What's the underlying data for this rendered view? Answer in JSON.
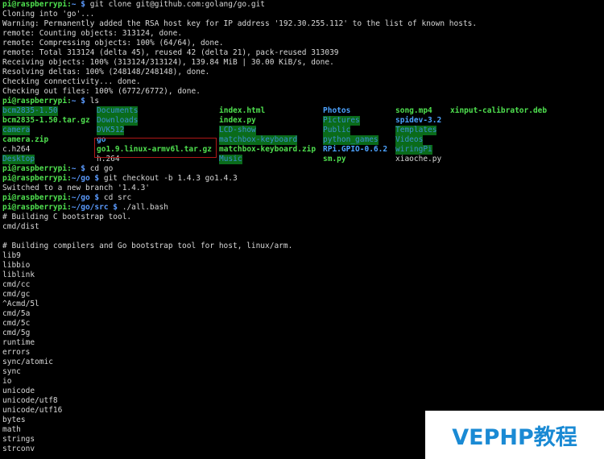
{
  "prompt": {
    "user_host": "pi@raspberrypi",
    "sep": ":",
    "dollar": "$"
  },
  "block1": {
    "path": "~",
    "command": "git clone git@github.com:golang/go.git",
    "output": [
      "Cloning into 'go'...",
      "Warning: Permanently added the RSA host key for IP address '192.30.255.112' to the list of known hosts.",
      "remote: Counting objects: 313124, done.",
      "remote: Compressing objects: 100% (64/64), done.",
      "remote: Total 313124 (delta 45), reused 42 (delta 21), pack-reused 313039",
      "Receiving objects: 100% (313124/313124), 139.84 MiB | 30.00 KiB/s, done.",
      "Resolving deltas: 100% (248148/248148), done.",
      "Checking connectivity... done.",
      "Checking out files: 100% (6772/6772), done."
    ]
  },
  "block2": {
    "path": "~",
    "command": "ls",
    "rows": [
      [
        {
          "name": "bcm2835-1.50",
          "type": "dir"
        },
        {
          "name": "Documents",
          "type": "dir"
        },
        {
          "name": "index.html",
          "type": "exe"
        },
        {
          "name": "Photos",
          "type": "dirb"
        },
        {
          "name": "song.mp4",
          "type": "exe"
        },
        {
          "name": "xinput-calibrator.deb",
          "type": "exe"
        }
      ],
      [
        {
          "name": "bcm2835-1.50.tar.gz",
          "type": "arch"
        },
        {
          "name": "Downloads",
          "type": "dir"
        },
        {
          "name": "index.py",
          "type": "exe"
        },
        {
          "name": "Pictures",
          "type": "dir"
        },
        {
          "name": "spidev-3.2",
          "type": "dirb"
        }
      ],
      [
        {
          "name": "camera",
          "type": "dir"
        },
        {
          "name": "DVK512",
          "type": "dir"
        },
        {
          "name": "LCD-show",
          "type": "dir"
        },
        {
          "name": "Public",
          "type": "dir"
        },
        {
          "name": "Templates",
          "type": "dir"
        }
      ],
      [
        {
          "name": "camera.zip",
          "type": "arch"
        },
        {
          "name": "go",
          "type": "dirb"
        },
        {
          "name": "matchbox-keyboard",
          "type": "dir"
        },
        {
          "name": "python_games",
          "type": "dir"
        },
        {
          "name": "Videos",
          "type": "dir"
        }
      ],
      [
        {
          "name": "c.h264",
          "type": "plain"
        },
        {
          "name": "go1.9.linux-armv6l.tar.gz",
          "type": "arch"
        },
        {
          "name": "matchbox-keyboard.zip",
          "type": "arch"
        },
        {
          "name": "RPi.GPIO-0.6.2",
          "type": "dirb"
        },
        {
          "name": "wiringPi",
          "type": "dir"
        }
      ],
      [
        {
          "name": "Desktop",
          "type": "dir"
        },
        {
          "name": "h.264",
          "type": "plain"
        },
        {
          "name": "Music",
          "type": "dir"
        },
        {
          "name": "sm.py",
          "type": "exe"
        },
        {
          "name": "xiaoche.py",
          "type": "plain"
        }
      ]
    ]
  },
  "block3": [
    {
      "path": "~",
      "command": "cd go",
      "output": []
    },
    {
      "path": "~/go",
      "command": "git checkout -b 1.4.3 go1.4.3",
      "output": [
        "Switched to a new branch '1.4.3'"
      ]
    },
    {
      "path": "~/go",
      "command": "cd src",
      "output": []
    },
    {
      "path": "~/go/src",
      "command": "./all.bash",
      "output": [
        "# Building C bootstrap tool.",
        "cmd/dist",
        "",
        "# Building compilers and Go bootstrap tool for host, linux/arm.",
        "lib9",
        "libbio",
        "liblink",
        "cmd/cc",
        "cmd/gc",
        "^Acmd/5l",
        "cmd/5a",
        "cmd/5c",
        "cmd/5g",
        "runtime",
        "errors",
        "sync/atomic",
        "sync",
        "io",
        "unicode",
        "unicode/utf8",
        "unicode/utf16",
        "bytes",
        "math",
        "strings",
        "strconv"
      ]
    }
  ],
  "watermark": {
    "text": "VEPHP教程"
  }
}
